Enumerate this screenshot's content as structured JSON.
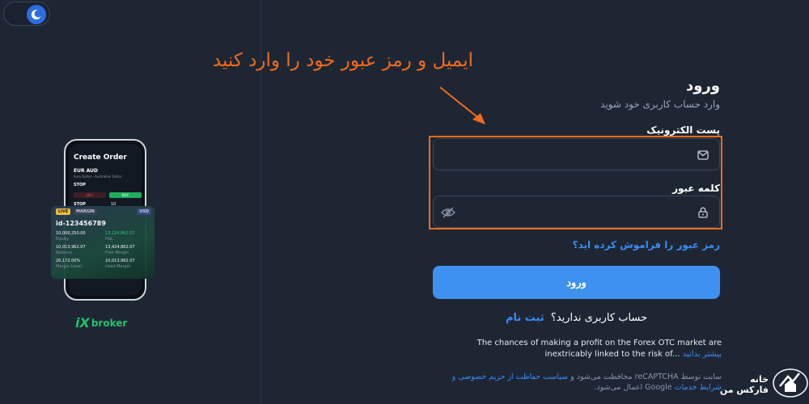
{
  "annotation": {
    "text": "ایمیل و رمز عبور خود را وارد کنید"
  },
  "login": {
    "title": "ورود",
    "subtitle": "وارد حساب کاربری خود شوید",
    "email_label": "پست الکترونیک",
    "email_value": "",
    "password_label": "کلمه عبور",
    "password_value": "",
    "forgot_link": "رمز عبور را فراموش کرده اید؟",
    "submit_label": "ورود",
    "signup_prompt": "حساب کاربری ندارید؟",
    "signup_link": "ثبت نام",
    "risk_text": "The chances of making a profit on the Forex OTC market are inextricably linked to the risk of...",
    "risk_more": "بیشتر بدانید",
    "recaptcha_text": "سایت توسط reCAPTCHA محافظت می‌شود و",
    "recaptcha_link": "سیاست حفاظت از حریم خصوصی و شرایط خدمات",
    "recaptcha_suffix": "Google اعمال می‌شود."
  },
  "phone": {
    "title": "Create Order",
    "pair": "EUR AUD",
    "pair_desc": "Euro Dollar - Australian Dollar",
    "stop": "STOP",
    "sell": "SELL",
    "buy": "BUY",
    "stop2": "STOP",
    "qty": "10"
  },
  "card": {
    "live": "LIVE",
    "margin": "MARGIN",
    "currency": "USD",
    "account_id": "id-123456789",
    "equity_value": "10,000,250.00",
    "equity_label": "Equity",
    "pl_value": "13,124,862.07",
    "pl_label": "P&L",
    "balance_value": "10,013,962.07",
    "balance_label": "Balance",
    "free_margin_value": "13,424,862.07",
    "free_margin_label": "Free Margin",
    "margin_level_value": "20,172.00%",
    "margin_level_label": "Margin Level",
    "used_margin_value": "10,013,962.07",
    "used_margin_label": "Used Margin"
  },
  "brand": {
    "mark": "iX",
    "name": "broker"
  },
  "watermark": {
    "text": "خانه فارکس من"
  },
  "colors": {
    "accent": "#3f91ef",
    "highlight": "#ef6c1b",
    "background": "#1e2634",
    "brand": "#22c26b"
  },
  "icons": {
    "theme": "moon-icon",
    "email": "mail-icon",
    "password": "lock-icon",
    "visibility": "eye-off-icon"
  }
}
